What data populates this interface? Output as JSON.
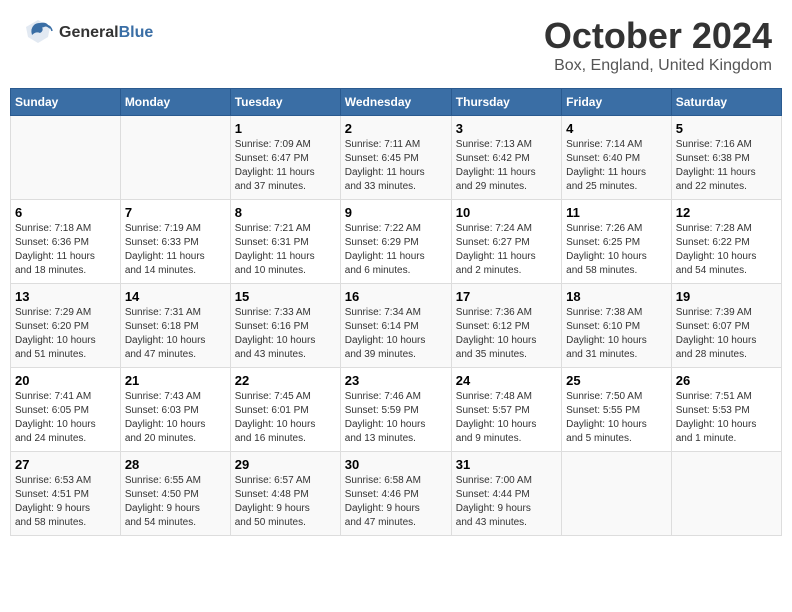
{
  "header": {
    "logo_general": "General",
    "logo_blue": "Blue",
    "month_title": "October 2024",
    "location": "Box, England, United Kingdom"
  },
  "weekdays": [
    "Sunday",
    "Monday",
    "Tuesday",
    "Wednesday",
    "Thursday",
    "Friday",
    "Saturday"
  ],
  "weeks": [
    [
      {
        "day": "",
        "info": ""
      },
      {
        "day": "",
        "info": ""
      },
      {
        "day": "1",
        "info": "Sunrise: 7:09 AM\nSunset: 6:47 PM\nDaylight: 11 hours\nand 37 minutes."
      },
      {
        "day": "2",
        "info": "Sunrise: 7:11 AM\nSunset: 6:45 PM\nDaylight: 11 hours\nand 33 minutes."
      },
      {
        "day": "3",
        "info": "Sunrise: 7:13 AM\nSunset: 6:42 PM\nDaylight: 11 hours\nand 29 minutes."
      },
      {
        "day": "4",
        "info": "Sunrise: 7:14 AM\nSunset: 6:40 PM\nDaylight: 11 hours\nand 25 minutes."
      },
      {
        "day": "5",
        "info": "Sunrise: 7:16 AM\nSunset: 6:38 PM\nDaylight: 11 hours\nand 22 minutes."
      }
    ],
    [
      {
        "day": "6",
        "info": "Sunrise: 7:18 AM\nSunset: 6:36 PM\nDaylight: 11 hours\nand 18 minutes."
      },
      {
        "day": "7",
        "info": "Sunrise: 7:19 AM\nSunset: 6:33 PM\nDaylight: 11 hours\nand 14 minutes."
      },
      {
        "day": "8",
        "info": "Sunrise: 7:21 AM\nSunset: 6:31 PM\nDaylight: 11 hours\nand 10 minutes."
      },
      {
        "day": "9",
        "info": "Sunrise: 7:22 AM\nSunset: 6:29 PM\nDaylight: 11 hours\nand 6 minutes."
      },
      {
        "day": "10",
        "info": "Sunrise: 7:24 AM\nSunset: 6:27 PM\nDaylight: 11 hours\nand 2 minutes."
      },
      {
        "day": "11",
        "info": "Sunrise: 7:26 AM\nSunset: 6:25 PM\nDaylight: 10 hours\nand 58 minutes."
      },
      {
        "day": "12",
        "info": "Sunrise: 7:28 AM\nSunset: 6:22 PM\nDaylight: 10 hours\nand 54 minutes."
      }
    ],
    [
      {
        "day": "13",
        "info": "Sunrise: 7:29 AM\nSunset: 6:20 PM\nDaylight: 10 hours\nand 51 minutes."
      },
      {
        "day": "14",
        "info": "Sunrise: 7:31 AM\nSunset: 6:18 PM\nDaylight: 10 hours\nand 47 minutes."
      },
      {
        "day": "15",
        "info": "Sunrise: 7:33 AM\nSunset: 6:16 PM\nDaylight: 10 hours\nand 43 minutes."
      },
      {
        "day": "16",
        "info": "Sunrise: 7:34 AM\nSunset: 6:14 PM\nDaylight: 10 hours\nand 39 minutes."
      },
      {
        "day": "17",
        "info": "Sunrise: 7:36 AM\nSunset: 6:12 PM\nDaylight: 10 hours\nand 35 minutes."
      },
      {
        "day": "18",
        "info": "Sunrise: 7:38 AM\nSunset: 6:10 PM\nDaylight: 10 hours\nand 31 minutes."
      },
      {
        "day": "19",
        "info": "Sunrise: 7:39 AM\nSunset: 6:07 PM\nDaylight: 10 hours\nand 28 minutes."
      }
    ],
    [
      {
        "day": "20",
        "info": "Sunrise: 7:41 AM\nSunset: 6:05 PM\nDaylight: 10 hours\nand 24 minutes."
      },
      {
        "day": "21",
        "info": "Sunrise: 7:43 AM\nSunset: 6:03 PM\nDaylight: 10 hours\nand 20 minutes."
      },
      {
        "day": "22",
        "info": "Sunrise: 7:45 AM\nSunset: 6:01 PM\nDaylight: 10 hours\nand 16 minutes."
      },
      {
        "day": "23",
        "info": "Sunrise: 7:46 AM\nSunset: 5:59 PM\nDaylight: 10 hours\nand 13 minutes."
      },
      {
        "day": "24",
        "info": "Sunrise: 7:48 AM\nSunset: 5:57 PM\nDaylight: 10 hours\nand 9 minutes."
      },
      {
        "day": "25",
        "info": "Sunrise: 7:50 AM\nSunset: 5:55 PM\nDaylight: 10 hours\nand 5 minutes."
      },
      {
        "day": "26",
        "info": "Sunrise: 7:51 AM\nSunset: 5:53 PM\nDaylight: 10 hours\nand 1 minute."
      }
    ],
    [
      {
        "day": "27",
        "info": "Sunrise: 6:53 AM\nSunset: 4:51 PM\nDaylight: 9 hours\nand 58 minutes."
      },
      {
        "day": "28",
        "info": "Sunrise: 6:55 AM\nSunset: 4:50 PM\nDaylight: 9 hours\nand 54 minutes."
      },
      {
        "day": "29",
        "info": "Sunrise: 6:57 AM\nSunset: 4:48 PM\nDaylight: 9 hours\nand 50 minutes."
      },
      {
        "day": "30",
        "info": "Sunrise: 6:58 AM\nSunset: 4:46 PM\nDaylight: 9 hours\nand 47 minutes."
      },
      {
        "day": "31",
        "info": "Sunrise: 7:00 AM\nSunset: 4:44 PM\nDaylight: 9 hours\nand 43 minutes."
      },
      {
        "day": "",
        "info": ""
      },
      {
        "day": "",
        "info": ""
      }
    ]
  ]
}
